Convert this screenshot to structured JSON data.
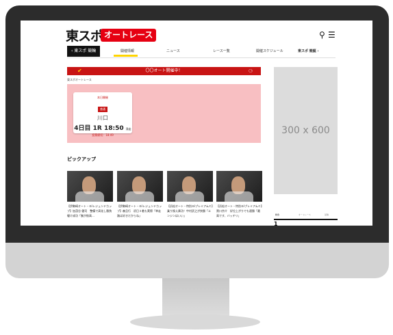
{
  "header": {
    "logo_text": "東スポ",
    "logo_badge": "オートレース",
    "search_icon": "search-icon",
    "menu_icon": "menu-icon"
  },
  "nav": {
    "back_label": "‹ 東スポ 競輪",
    "items": [
      {
        "label": "開催情報"
      },
      {
        "label": "ニュース"
      },
      {
        "label": "レース一覧"
      },
      {
        "label": "開催スケジュール"
      },
      {
        "label": "東スポ 競艇 ›"
      }
    ],
    "active_index": 0,
    "active_color": "#ffd400"
  },
  "banner": {
    "text": "〇〇オート開催中！",
    "check_icon": "check-icon",
    "moto_icon": "motorcycle-icon",
    "color": "#c81414"
  },
  "breadcrumb": "東スポオートレース",
  "race_card": {
    "label": "本日開催",
    "tag": "普通",
    "venue": "川口",
    "day": "4日目",
    "race": "1R",
    "time": "18:50",
    "time_suffix": "発走",
    "deadline": "投票締切：18:49"
  },
  "ad": {
    "text": "300 x 600"
  },
  "pickup": {
    "title": "ピックアップ",
    "items": [
      {
        "text": "【伊勢崎オート・ＧⅠレジェンドカップ】加茂谷 健司　整備で高化し勝負駆け成功「腕が航高…"
      },
      {
        "text": "【伊勢崎オート・ＧⅠレジェンドカップ】森且行　初日３着も実際「単走路は好きだからね」"
      },
      {
        "text": "【浜松オート・特別ＧⅠプレミアムＣ】乗り換え奏功！中村武之が快勝「エンジンはいい」"
      },
      {
        "text": "【浜松オート・特別ＧⅠプレミアムＣ】黒川京介　好位上がりでも連勝「最高です、バッチリ」"
      }
    ]
  },
  "ranking": {
    "tabs": [
      "総合",
      "オートレース",
      "競輪"
    ],
    "first": "1"
  }
}
